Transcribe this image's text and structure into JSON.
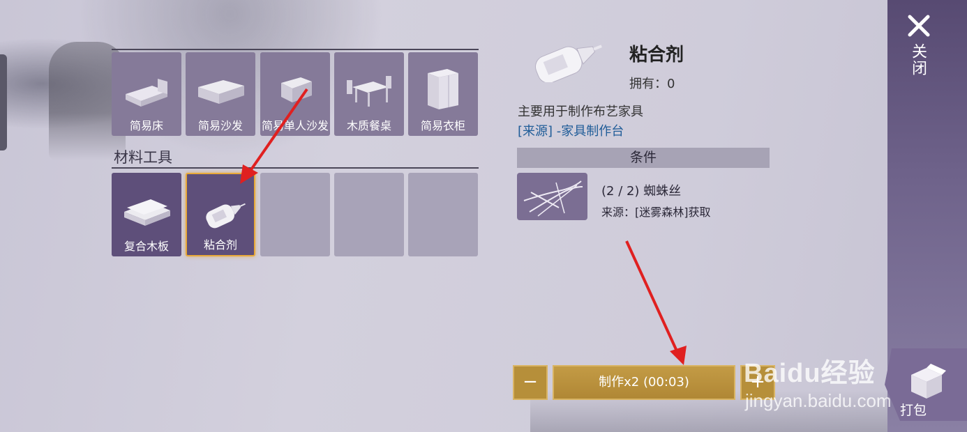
{
  "furniture_row": [
    {
      "label": "简易床",
      "icon": "bed-icon"
    },
    {
      "label": "简易沙发",
      "icon": "sofa-icon"
    },
    {
      "label": "简易单人沙发",
      "icon": "armchair-icon"
    },
    {
      "label": "木质餐桌",
      "icon": "dining-table-icon"
    },
    {
      "label": "简易衣柜",
      "icon": "wardrobe-icon"
    }
  ],
  "section": {
    "title": "材料工具"
  },
  "materials_row": [
    {
      "label": "复合木板",
      "icon": "wood-board-icon"
    },
    {
      "label": "粘合剂",
      "icon": "glue-bottle-icon",
      "selected": true
    }
  ],
  "detail": {
    "name": "粘合剂",
    "owned": "拥有：0",
    "description": "主要用于制作布艺家具",
    "source": "[来源] -家具制作台",
    "conditions_header": "条件",
    "condition": {
      "name": "(2 / 2) 蜘蛛丝",
      "source": "来源：[迷雾森林]获取",
      "icon": "spider-silk-icon"
    }
  },
  "craft": {
    "minus": "−",
    "button": "制作x2 (00:03)",
    "plus": "+"
  },
  "sidebar": {
    "close": "关闭",
    "pack": "打包"
  },
  "watermark": {
    "logo": "Baidu经验",
    "url": "jingyan.baidu.com"
  },
  "colors": {
    "accent_gold": "#b68f3a",
    "tile_purple": "#7d7193",
    "selected_border": "#e8a93a",
    "link_blue": "#1f5c98",
    "arrow_red": "#e02020"
  }
}
